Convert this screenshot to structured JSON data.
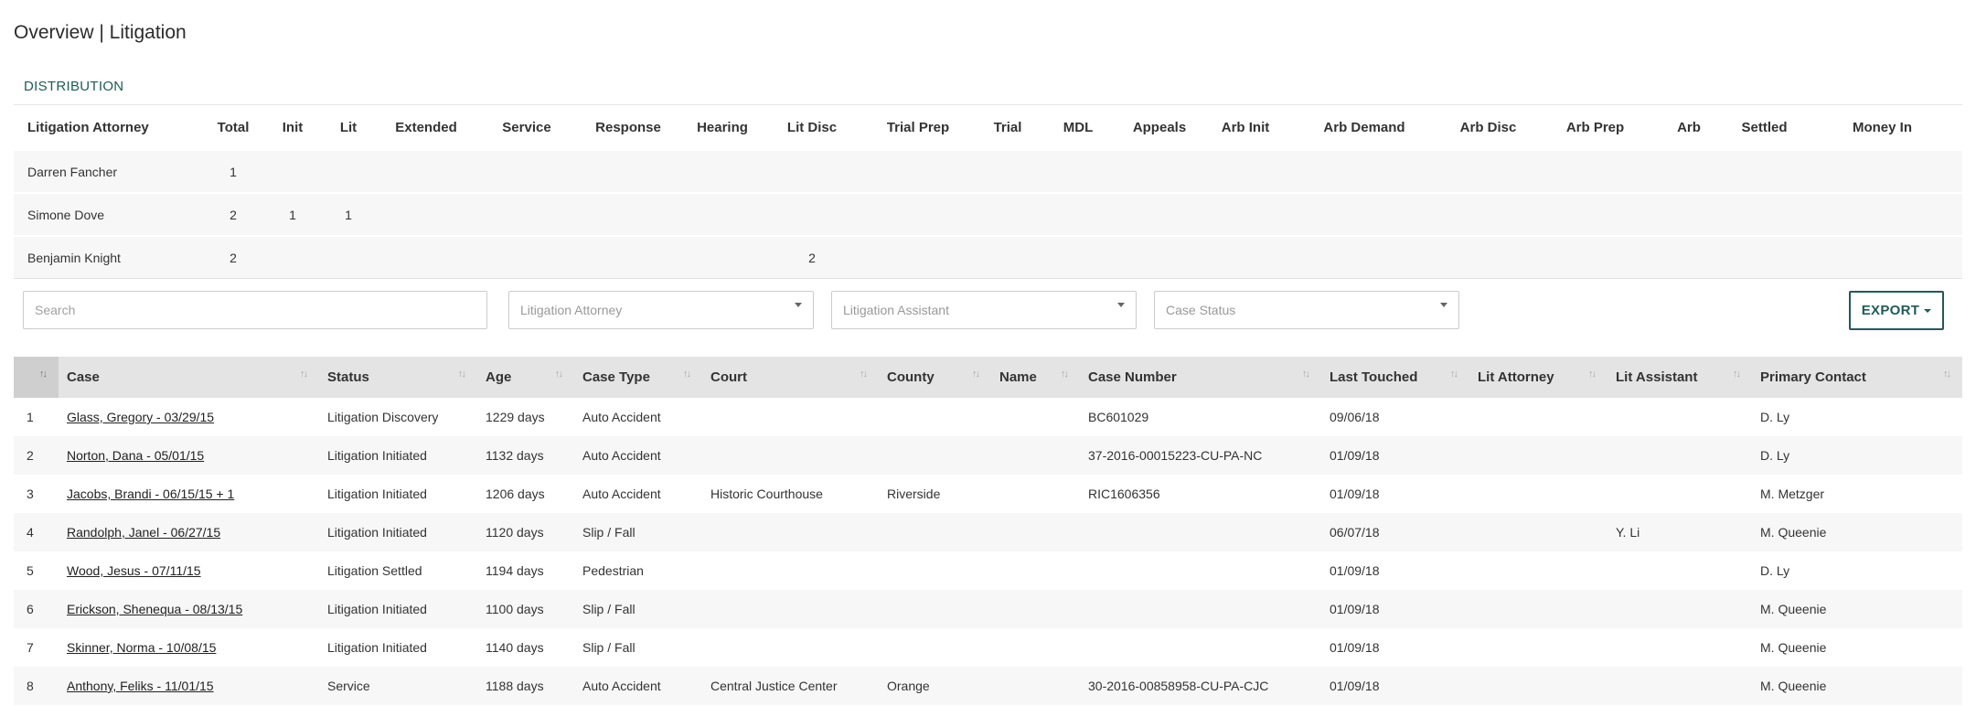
{
  "page": {
    "title": "Overview | Litigation"
  },
  "distribution": {
    "label": "DISTRIBUTION",
    "columns": [
      "Litigation Attorney",
      "Total",
      "Init",
      "Lit",
      "Extended",
      "Service",
      "Response",
      "Hearing",
      "Lit Disc",
      "Trial Prep",
      "Trial",
      "MDL",
      "Appeals",
      "Arb Init",
      "Arb Demand",
      "Arb Disc",
      "Arb Prep",
      "Arb",
      "Settled",
      "Money In"
    ],
    "rows": [
      [
        "Darren Fancher",
        "1",
        "",
        "",
        "",
        "",
        "",
        "",
        "",
        "",
        "",
        "",
        "",
        "",
        "",
        "",
        "",
        "",
        "",
        ""
      ],
      [
        "Simone Dove",
        "2",
        "1",
        "1",
        "",
        "",
        "",
        "",
        "",
        "",
        "",
        "",
        "",
        "",
        "",
        "",
        "",
        "",
        "",
        ""
      ],
      [
        "Benjamin Knight",
        "2",
        "",
        "",
        "",
        "",
        "",
        "",
        "2",
        "",
        "",
        "",
        "",
        "",
        "",
        "",
        "",
        "",
        "",
        ""
      ]
    ]
  },
  "filters": {
    "search_placeholder": "Search",
    "litigation_attorney": "Litigation Attorney",
    "litigation_assistant": "Litigation Assistant",
    "case_status": "Case Status",
    "export_label": "EXPORT"
  },
  "cases": {
    "columns": [
      "Case",
      "Status",
      "Age",
      "Case Type",
      "Court",
      "County",
      "Name",
      "Case Number",
      "Last Touched",
      "Lit Attorney",
      "Lit Assistant",
      "Primary Contact"
    ],
    "rows": [
      {
        "idx": "1",
        "case": "Glass, Gregory - 03/29/15",
        "status": "Litigation Discovery",
        "age": "1229 days",
        "type": "Auto Accident",
        "court": "",
        "county": "",
        "name": "",
        "number": "BC601029",
        "touched": "09/06/18",
        "attorney": "",
        "assistant": "",
        "contact": "D. Ly"
      },
      {
        "idx": "2",
        "case": "Norton, Dana - 05/01/15",
        "status": "Litigation Initiated",
        "age": "1132 days",
        "type": "Auto Accident",
        "court": "",
        "county": "",
        "name": "",
        "number": "37-2016-00015223-CU-PA-NC",
        "touched": "01/09/18",
        "attorney": "",
        "assistant": "",
        "contact": "D. Ly"
      },
      {
        "idx": "3",
        "case": "Jacobs, Brandi - 06/15/15 + 1",
        "status": "Litigation Initiated",
        "age": "1206 days",
        "type": "Auto Accident",
        "court": "Historic Courthouse",
        "county": "Riverside",
        "name": "",
        "number": "RIC1606356",
        "touched": "01/09/18",
        "attorney": "",
        "assistant": "",
        "contact": "M. Metzger"
      },
      {
        "idx": "4",
        "case": "Randolph, Janel - 06/27/15",
        "status": "Litigation Initiated",
        "age": "1120 days",
        "type": "Slip / Fall",
        "court": "",
        "county": "",
        "name": "",
        "number": "",
        "touched": "06/07/18",
        "attorney": "",
        "assistant": "Y. Li",
        "contact": "M. Queenie"
      },
      {
        "idx": "5",
        "case": "Wood, Jesus - 07/11/15",
        "status": "Litigation Settled",
        "age": "1194 days",
        "type": "Pedestrian",
        "court": "",
        "county": "",
        "name": "",
        "number": "",
        "touched": "01/09/18",
        "attorney": "",
        "assistant": "",
        "contact": "D. Ly"
      },
      {
        "idx": "6",
        "case": "Erickson, Shenequa - 08/13/15",
        "status": "Litigation Initiated",
        "age": "1100 days",
        "type": "Slip / Fall",
        "court": "",
        "county": "",
        "name": "",
        "number": "",
        "touched": "01/09/18",
        "attorney": "",
        "assistant": "",
        "contact": "M. Queenie"
      },
      {
        "idx": "7",
        "case": "Skinner, Norma - 10/08/15",
        "status": "Litigation Initiated",
        "age": "1140 days",
        "type": "Slip / Fall",
        "court": "",
        "county": "",
        "name": "",
        "number": "",
        "touched": "01/09/18",
        "attorney": "",
        "assistant": "",
        "contact": "M. Queenie"
      },
      {
        "idx": "8",
        "case": "Anthony, Feliks - 11/01/15",
        "status": "Service",
        "age": "1188 days",
        "type": "Auto Accident",
        "court": "Central Justice Center",
        "county": "Orange",
        "name": "",
        "number": "30-2016-00858958-CU-PA-CJC",
        "touched": "01/09/18",
        "attorney": "",
        "assistant": "",
        "contact": "M. Queenie"
      }
    ]
  },
  "icons": {
    "sort": "sort-arrows-icon",
    "expand": "caret-down-icon"
  },
  "colors": {
    "accent": "#1e5c56",
    "header_bg": "#e4e4e4",
    "stripe": "#f7f7f7"
  }
}
